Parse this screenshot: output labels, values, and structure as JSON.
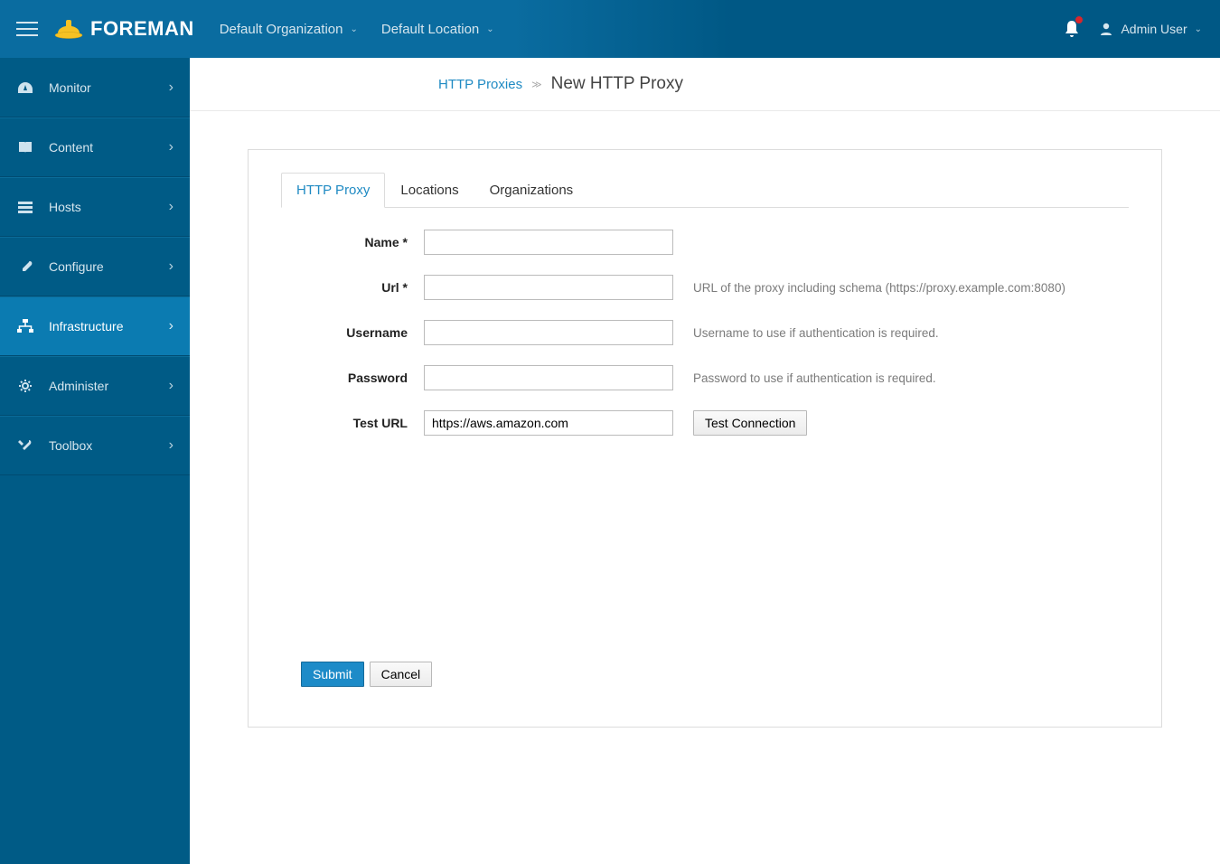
{
  "header": {
    "brand": "FOREMAN",
    "org": "Default Organization",
    "loc": "Default Location",
    "user": "Admin User"
  },
  "sidebar": {
    "items": [
      {
        "label": "Monitor",
        "icon": "dashboard"
      },
      {
        "label": "Content",
        "icon": "book"
      },
      {
        "label": "Hosts",
        "icon": "servers"
      },
      {
        "label": "Configure",
        "icon": "wrench"
      },
      {
        "label": "Infrastructure",
        "icon": "network",
        "active": true
      },
      {
        "label": "Administer",
        "icon": "gear"
      },
      {
        "label": "Toolbox",
        "icon": "tools"
      }
    ]
  },
  "breadcrumb": {
    "parent": "HTTP Proxies",
    "current": "New HTTP Proxy"
  },
  "tabs": [
    {
      "label": "HTTP Proxy",
      "active": true
    },
    {
      "label": "Locations"
    },
    {
      "label": "Organizations"
    }
  ],
  "form": {
    "name": {
      "label": "Name *",
      "value": ""
    },
    "url": {
      "label": "Url *",
      "value": "",
      "help": "URL of the proxy including schema (https://proxy.example.com:8080)"
    },
    "username": {
      "label": "Username",
      "value": "",
      "help": "Username to use if authentication is required."
    },
    "password": {
      "label": "Password",
      "value": "",
      "help": "Password to use if authentication is required."
    },
    "testurl": {
      "label": "Test URL",
      "value": "https://aws.amazon.com",
      "button": "Test Connection"
    }
  },
  "actions": {
    "submit": "Submit",
    "cancel": "Cancel"
  }
}
